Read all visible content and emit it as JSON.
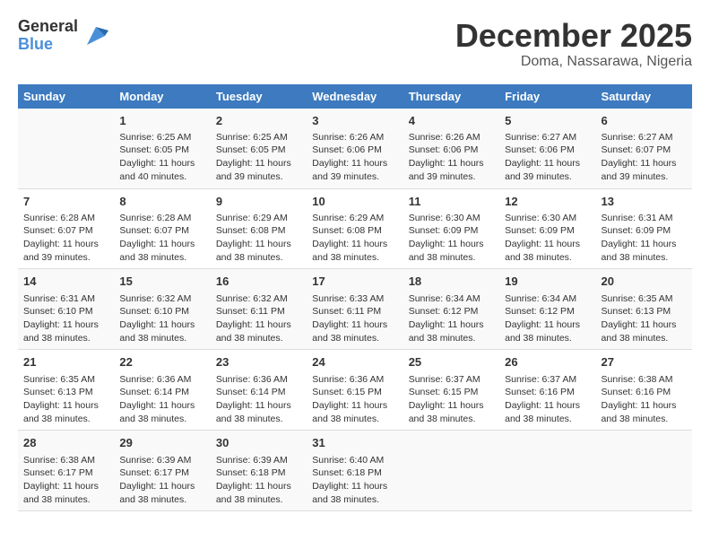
{
  "logo": {
    "text_general": "General",
    "text_blue": "Blue"
  },
  "title": "December 2025",
  "location": "Doma, Nassarawa, Nigeria",
  "weekdays": [
    "Sunday",
    "Monday",
    "Tuesday",
    "Wednesday",
    "Thursday",
    "Friday",
    "Saturday"
  ],
  "weeks": [
    [
      {
        "day": "",
        "info": ""
      },
      {
        "day": "1",
        "info": "Sunrise: 6:25 AM\nSunset: 6:05 PM\nDaylight: 11 hours\nand 40 minutes."
      },
      {
        "day": "2",
        "info": "Sunrise: 6:25 AM\nSunset: 6:05 PM\nDaylight: 11 hours\nand 39 minutes."
      },
      {
        "day": "3",
        "info": "Sunrise: 6:26 AM\nSunset: 6:06 PM\nDaylight: 11 hours\nand 39 minutes."
      },
      {
        "day": "4",
        "info": "Sunrise: 6:26 AM\nSunset: 6:06 PM\nDaylight: 11 hours\nand 39 minutes."
      },
      {
        "day": "5",
        "info": "Sunrise: 6:27 AM\nSunset: 6:06 PM\nDaylight: 11 hours\nand 39 minutes."
      },
      {
        "day": "6",
        "info": "Sunrise: 6:27 AM\nSunset: 6:07 PM\nDaylight: 11 hours\nand 39 minutes."
      }
    ],
    [
      {
        "day": "7",
        "info": "Sunrise: 6:28 AM\nSunset: 6:07 PM\nDaylight: 11 hours\nand 39 minutes."
      },
      {
        "day": "8",
        "info": "Sunrise: 6:28 AM\nSunset: 6:07 PM\nDaylight: 11 hours\nand 38 minutes."
      },
      {
        "day": "9",
        "info": "Sunrise: 6:29 AM\nSunset: 6:08 PM\nDaylight: 11 hours\nand 38 minutes."
      },
      {
        "day": "10",
        "info": "Sunrise: 6:29 AM\nSunset: 6:08 PM\nDaylight: 11 hours\nand 38 minutes."
      },
      {
        "day": "11",
        "info": "Sunrise: 6:30 AM\nSunset: 6:09 PM\nDaylight: 11 hours\nand 38 minutes."
      },
      {
        "day": "12",
        "info": "Sunrise: 6:30 AM\nSunset: 6:09 PM\nDaylight: 11 hours\nand 38 minutes."
      },
      {
        "day": "13",
        "info": "Sunrise: 6:31 AM\nSunset: 6:09 PM\nDaylight: 11 hours\nand 38 minutes."
      }
    ],
    [
      {
        "day": "14",
        "info": "Sunrise: 6:31 AM\nSunset: 6:10 PM\nDaylight: 11 hours\nand 38 minutes."
      },
      {
        "day": "15",
        "info": "Sunrise: 6:32 AM\nSunset: 6:10 PM\nDaylight: 11 hours\nand 38 minutes."
      },
      {
        "day": "16",
        "info": "Sunrise: 6:32 AM\nSunset: 6:11 PM\nDaylight: 11 hours\nand 38 minutes."
      },
      {
        "day": "17",
        "info": "Sunrise: 6:33 AM\nSunset: 6:11 PM\nDaylight: 11 hours\nand 38 minutes."
      },
      {
        "day": "18",
        "info": "Sunrise: 6:34 AM\nSunset: 6:12 PM\nDaylight: 11 hours\nand 38 minutes."
      },
      {
        "day": "19",
        "info": "Sunrise: 6:34 AM\nSunset: 6:12 PM\nDaylight: 11 hours\nand 38 minutes."
      },
      {
        "day": "20",
        "info": "Sunrise: 6:35 AM\nSunset: 6:13 PM\nDaylight: 11 hours\nand 38 minutes."
      }
    ],
    [
      {
        "day": "21",
        "info": "Sunrise: 6:35 AM\nSunset: 6:13 PM\nDaylight: 11 hours\nand 38 minutes."
      },
      {
        "day": "22",
        "info": "Sunrise: 6:36 AM\nSunset: 6:14 PM\nDaylight: 11 hours\nand 38 minutes."
      },
      {
        "day": "23",
        "info": "Sunrise: 6:36 AM\nSunset: 6:14 PM\nDaylight: 11 hours\nand 38 minutes."
      },
      {
        "day": "24",
        "info": "Sunrise: 6:36 AM\nSunset: 6:15 PM\nDaylight: 11 hours\nand 38 minutes."
      },
      {
        "day": "25",
        "info": "Sunrise: 6:37 AM\nSunset: 6:15 PM\nDaylight: 11 hours\nand 38 minutes."
      },
      {
        "day": "26",
        "info": "Sunrise: 6:37 AM\nSunset: 6:16 PM\nDaylight: 11 hours\nand 38 minutes."
      },
      {
        "day": "27",
        "info": "Sunrise: 6:38 AM\nSunset: 6:16 PM\nDaylight: 11 hours\nand 38 minutes."
      }
    ],
    [
      {
        "day": "28",
        "info": "Sunrise: 6:38 AM\nSunset: 6:17 PM\nDaylight: 11 hours\nand 38 minutes."
      },
      {
        "day": "29",
        "info": "Sunrise: 6:39 AM\nSunset: 6:17 PM\nDaylight: 11 hours\nand 38 minutes."
      },
      {
        "day": "30",
        "info": "Sunrise: 6:39 AM\nSunset: 6:18 PM\nDaylight: 11 hours\nand 38 minutes."
      },
      {
        "day": "31",
        "info": "Sunrise: 6:40 AM\nSunset: 6:18 PM\nDaylight: 11 hours\nand 38 minutes."
      },
      {
        "day": "",
        "info": ""
      },
      {
        "day": "",
        "info": ""
      },
      {
        "day": "",
        "info": ""
      }
    ]
  ]
}
